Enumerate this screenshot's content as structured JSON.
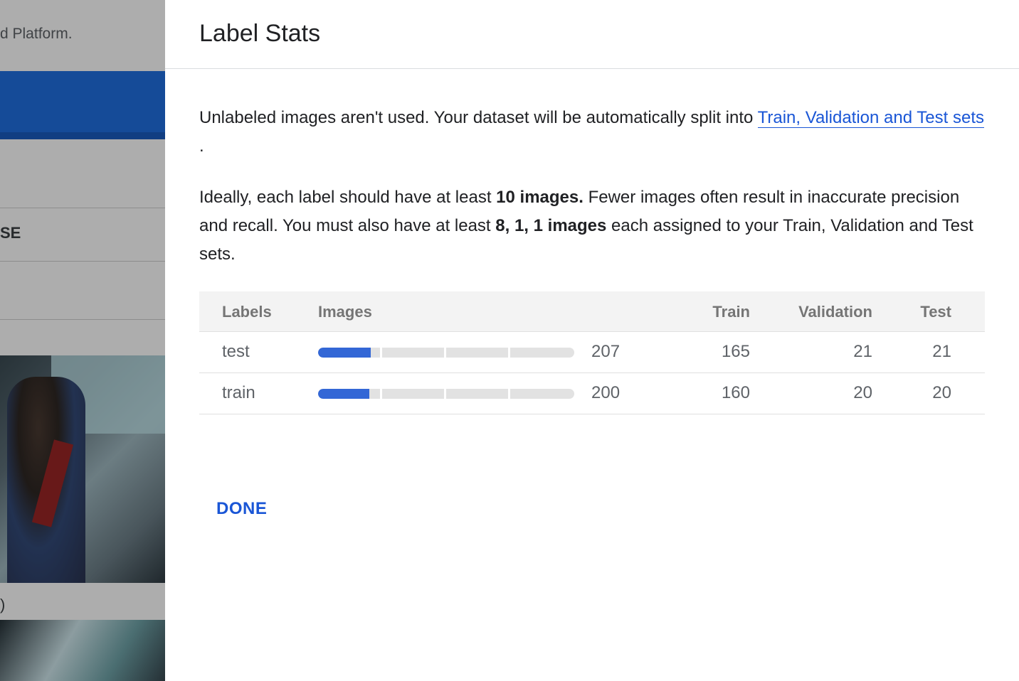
{
  "background": {
    "breadcrumb_fragment": "d Platform.",
    "row_label_fragment": "SE",
    "caption_fragment": ")"
  },
  "panel": {
    "title": "Label Stats",
    "intro_text": "Unlabeled images aren't used. Your dataset will be automatically split into ",
    "intro_link": "Train, Validation and Test sets ",
    "intro_end": ".",
    "guidance_1": "Ideally, each label should have at least ",
    "guidance_bold_1": "10 images.",
    "guidance_2": " Fewer images often result in inaccurate precision and recall. You must also have at least ",
    "guidance_bold_2": "8, 1, 1 images",
    "guidance_3": " each assigned to your Train, Validation and Test sets.",
    "done_label": "DONE"
  },
  "table": {
    "headers": {
      "labels": "Labels",
      "images": "Images",
      "train": "Train",
      "validation": "Validation",
      "test": "Test"
    },
    "rows": [
      {
        "label": "test",
        "images": "207",
        "train": "165",
        "validation": "21",
        "test": "21",
        "bar_fraction": 0.205
      },
      {
        "label": "train",
        "images": "200",
        "train": "160",
        "validation": "20",
        "test": "20",
        "bar_fraction": 0.2
      }
    ]
  },
  "colors": {
    "accent": "#1a56d6",
    "bar_fill": "#3367d6",
    "bar_track": "#e2e2e2",
    "bg_band": "#1f6fe0"
  }
}
